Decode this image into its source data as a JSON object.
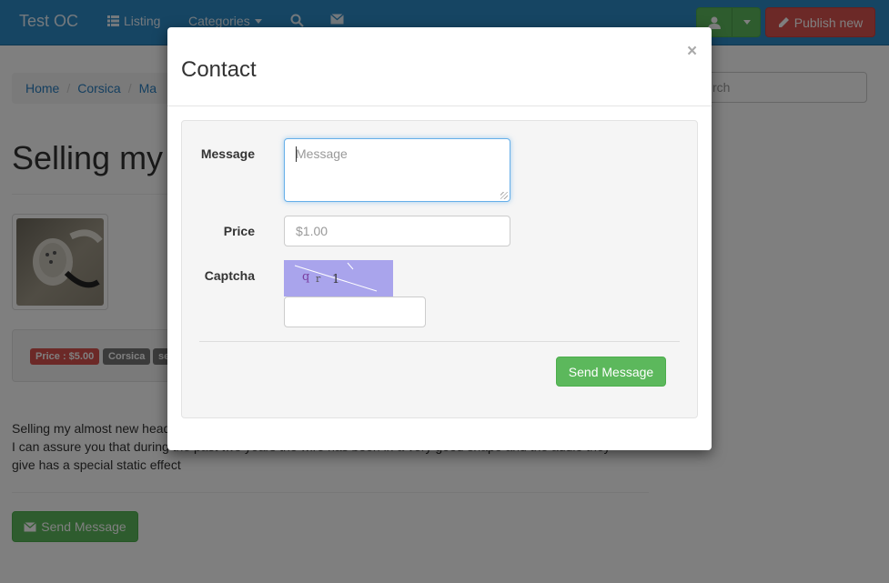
{
  "navbar": {
    "brand": "Test OC",
    "listing": "Listing",
    "categories": "Categories",
    "publish": "Publish new"
  },
  "breadcrumb": [
    "Home",
    "Corsica",
    "Ma"
  ],
  "search": {
    "placeholder": "rch"
  },
  "listing": {
    "title": "Selling my",
    "labels": {
      "price": "Price : $5.00",
      "location": "Corsica",
      "other": "se"
    },
    "description": [
      "Selling my almost new head",
      "I can assure you that during the past two years the wire has been in a very good shape and the audio they",
      "give has a special static effect"
    ],
    "send_button": "Send Message"
  },
  "modal": {
    "title": "Contact",
    "close": "×",
    "message_label": "Message",
    "message_placeholder": "Message",
    "price_label": "Price",
    "price_placeholder": "$1.00",
    "captcha_label": "Captcha",
    "captcha_text": "q r 1",
    "captcha_value": "",
    "send_button": "Send Message"
  },
  "colors": {
    "navbar": "#2c8ac7",
    "success": "#5cb85c",
    "danger": "#d9534f",
    "captcha_bg": "#a9a4ec"
  }
}
